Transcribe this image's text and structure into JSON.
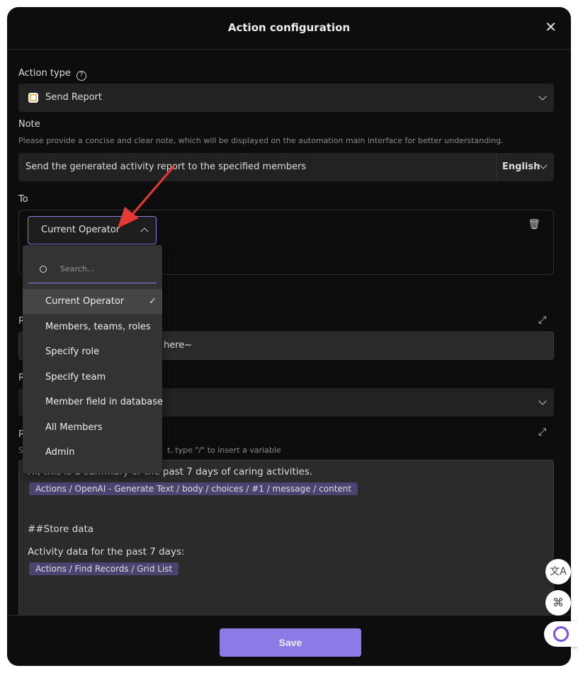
{
  "header": {
    "title": "Action configuration",
    "close_icon": "close-icon"
  },
  "action_type": {
    "label": "Action type",
    "help_icon": "question-circle-icon",
    "value": "Send Report",
    "icon": "report-icon"
  },
  "note": {
    "label": "Note",
    "hint": "Please provide a concise and clear note, which will be displayed on the automation main interface for better understanding.",
    "value": "Send the generated activity report to the specified members",
    "language": "English"
  },
  "to": {
    "label": "To",
    "selected": "Current Operator",
    "delete_icon": "trash-icon"
  },
  "dropdown": {
    "search_placeholder": "Search...",
    "items": [
      {
        "label": "Current Operator",
        "selected": true
      },
      {
        "label": "Members, teams, roles"
      },
      {
        "label": "Specify role"
      },
      {
        "label": "Specify team"
      },
      {
        "label": "Member field in database"
      },
      {
        "label": "All Members"
      },
      {
        "label": "Admin"
      }
    ]
  },
  "hidden_fields": {
    "label1": "R",
    "input1_fragment": "here~",
    "label2": "R",
    "label3": "R",
    "hint3_start": "S",
    "hint3_end": "t, type \"/\" to insert a variable"
  },
  "editor": {
    "line1": "Hi, this is a summary of the past 7 days of caring activities.",
    "tag1": "Actions / OpenAI - Generate Text / body / choices / #1 / message / content",
    "heading": "##Store data",
    "line2": "Activity data for the past 7 days:",
    "tag2": "Actions / Find Records / Grid List"
  },
  "footer": {
    "save_label": "Save"
  },
  "colors": {
    "accent": "#8c7ae6",
    "arrow": "#e53935",
    "tag_bg": "#4c4470"
  }
}
